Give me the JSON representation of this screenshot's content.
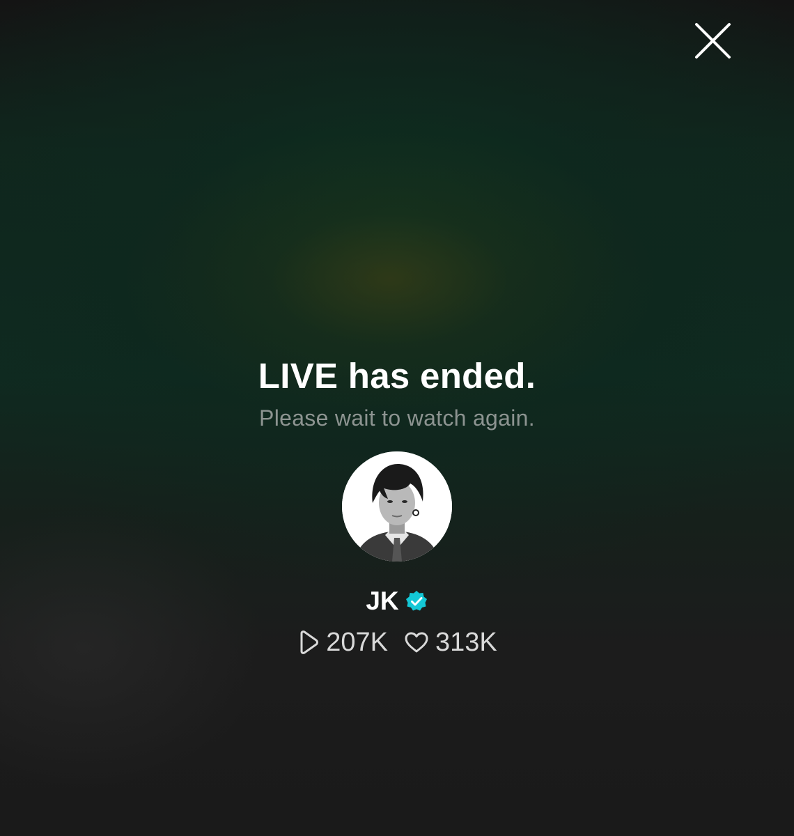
{
  "header": {
    "close_icon": "close-icon"
  },
  "main": {
    "title": "LIVE has ended.",
    "subtitle": "Please wait to watch again."
  },
  "profile": {
    "avatar": "avatar-photo",
    "name": "JK",
    "verified_icon": "verified-badge-icon",
    "verified_color": "#14c8d6"
  },
  "stats": {
    "views_icon": "play-icon",
    "views": "207K",
    "likes_icon": "heart-icon",
    "likes": "313K"
  }
}
